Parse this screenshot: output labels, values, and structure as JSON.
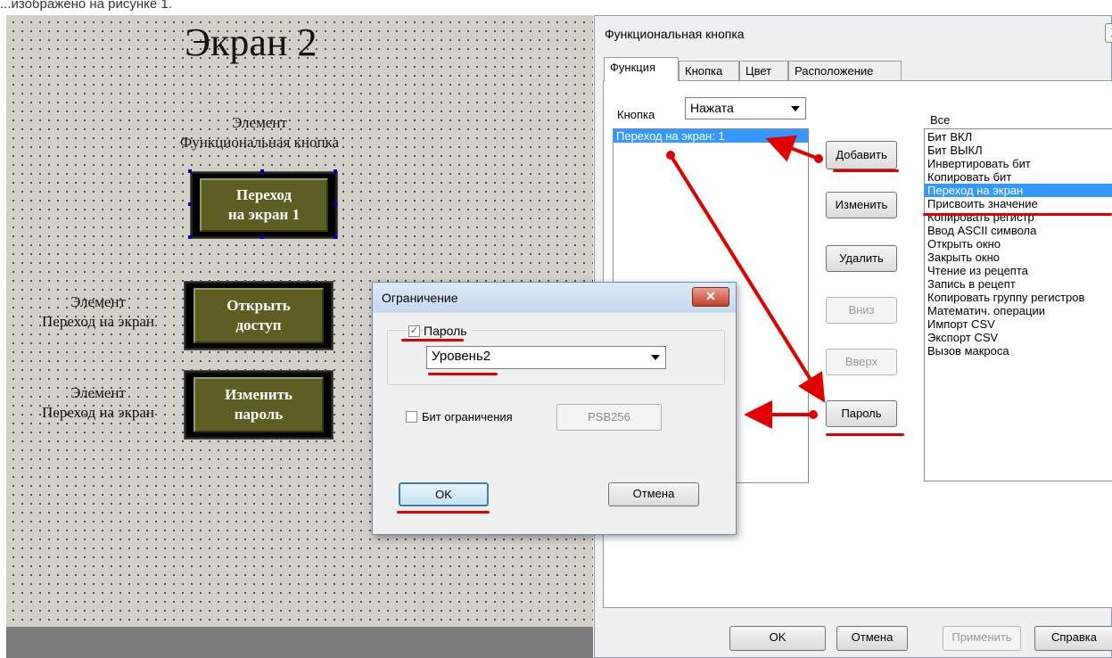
{
  "top_text": "...изображено на рисунке 1.",
  "canvas": {
    "screen_title": "Экран 2",
    "label1_line1": "Элемент",
    "label1_line2": "Функциональная кнопка",
    "label2_line1": "Элемент",
    "label2_line2": "Переход на экран",
    "label3_line1": "Элемент",
    "label3_line2": "Переход на экран",
    "btn1_line1": "Переход",
    "btn1_line2": "на экран 1",
    "btn2_line1": "Открыть",
    "btn2_line2": "доступ",
    "btn3_line1": "Изменить",
    "btn3_line2": "пароль"
  },
  "main_dialog": {
    "title": "Функциональная кнопка",
    "close": "X",
    "tabs": [
      "Функция",
      "Кнопка",
      "Цвет",
      "Расположение"
    ],
    "button_label": "Кнопка",
    "button_state": "Нажата",
    "all_label": "Все",
    "actions_list": [
      "Переход на экран: 1"
    ],
    "side_buttons": {
      "add": "Добавить",
      "edit": "Изменить",
      "delete": "Удалить",
      "down": "Вниз",
      "up": "Вверх",
      "password": "Пароль"
    },
    "functions": [
      "Бит ВКЛ",
      "Бит ВЫКЛ",
      "Инвертировать бит",
      "Копировать бит",
      "Переход на экран",
      "Присвоить значение",
      "Копировать регистр",
      "Ввод ASCII символа",
      "Открыть окно",
      "Закрыть окно",
      "Чтение из рецепта",
      "Запись в рецепт",
      "Копировать группу регистров",
      "Математич. операции",
      "Импорт CSV",
      "Экспорт CSV",
      "Вызов макроса"
    ],
    "selected_function": "Переход на экран",
    "footer": {
      "ok": "OK",
      "cancel": "Отмена",
      "apply": "Применить",
      "help": "Справка"
    }
  },
  "restriction_dialog": {
    "title": "Ограничение",
    "close": "✕",
    "password_checkbox_label": "Пароль",
    "password_checked": true,
    "level_value": "Уровень2",
    "bit_checkbox_label": "Бит ограничения",
    "bit_checked": false,
    "bit_value": "PSB256",
    "ok": "OK",
    "cancel": "Отмена"
  },
  "colors": {
    "annotation_red": "#e00000",
    "selection_blue": "#3399ff",
    "hmi_button": "#5e5e24"
  }
}
